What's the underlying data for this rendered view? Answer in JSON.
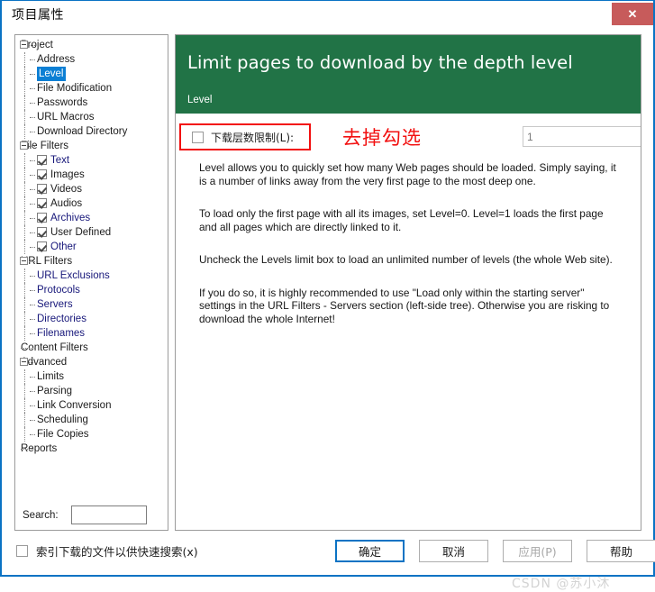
{
  "window": {
    "title": "项目属性",
    "close_label": "✕"
  },
  "tree": {
    "nodes": [
      {
        "label": "Project",
        "level": 0,
        "expander": "minus",
        "color": "black",
        "checkbox": false,
        "selected": false
      },
      {
        "label": "Address",
        "level": 1,
        "expander": "none",
        "color": "black",
        "checkbox": false,
        "selected": false
      },
      {
        "label": "Level",
        "level": 1,
        "expander": "none",
        "color": "black",
        "checkbox": false,
        "selected": true
      },
      {
        "label": "File Modification",
        "level": 1,
        "expander": "none",
        "color": "black",
        "checkbox": false,
        "selected": false
      },
      {
        "label": "Passwords",
        "level": 1,
        "expander": "none",
        "color": "black",
        "checkbox": false,
        "selected": false
      },
      {
        "label": "URL Macros",
        "level": 1,
        "expander": "none",
        "color": "black",
        "checkbox": false,
        "selected": false
      },
      {
        "label": "Download Directory",
        "level": 1,
        "expander": "none",
        "color": "black",
        "checkbox": false,
        "selected": false
      },
      {
        "label": "File Filters",
        "level": 0,
        "expander": "minus",
        "color": "black",
        "checkbox": false,
        "selected": false
      },
      {
        "label": "Text",
        "level": 1,
        "expander": "none",
        "color": "blue",
        "checkbox": true,
        "checked": true,
        "selected": false
      },
      {
        "label": "Images",
        "level": 1,
        "expander": "none",
        "color": "black",
        "checkbox": true,
        "checked": true,
        "selected": false
      },
      {
        "label": "Videos",
        "level": 1,
        "expander": "none",
        "color": "black",
        "checkbox": true,
        "checked": true,
        "selected": false
      },
      {
        "label": "Audios",
        "level": 1,
        "expander": "none",
        "color": "black",
        "checkbox": true,
        "checked": true,
        "selected": false
      },
      {
        "label": "Archives",
        "level": 1,
        "expander": "none",
        "color": "blue",
        "checkbox": true,
        "checked": true,
        "selected": false
      },
      {
        "label": "User Defined",
        "level": 1,
        "expander": "none",
        "color": "black",
        "checkbox": true,
        "checked": true,
        "selected": false
      },
      {
        "label": "Other",
        "level": 1,
        "expander": "none",
        "color": "blue",
        "checkbox": true,
        "checked": true,
        "selected": false
      },
      {
        "label": "URL Filters",
        "level": 0,
        "expander": "minus",
        "color": "black",
        "checkbox": false,
        "selected": false
      },
      {
        "label": "URL Exclusions",
        "level": 1,
        "expander": "none",
        "color": "blue",
        "checkbox": false,
        "selected": false
      },
      {
        "label": "Protocols",
        "level": 1,
        "expander": "none",
        "color": "blue",
        "checkbox": false,
        "selected": false
      },
      {
        "label": "Servers",
        "level": 1,
        "expander": "none",
        "color": "blue",
        "checkbox": false,
        "selected": false
      },
      {
        "label": "Directories",
        "level": 1,
        "expander": "none",
        "color": "blue",
        "checkbox": false,
        "selected": false
      },
      {
        "label": "Filenames",
        "level": 1,
        "expander": "none",
        "color": "blue",
        "checkbox": false,
        "selected": false
      },
      {
        "label": "Content Filters",
        "level": 0,
        "expander": "none",
        "color": "black",
        "checkbox": false,
        "selected": false
      },
      {
        "label": "Advanced",
        "level": 0,
        "expander": "minus",
        "color": "black",
        "checkbox": false,
        "selected": false
      },
      {
        "label": "Limits",
        "level": 1,
        "expander": "none",
        "color": "black",
        "checkbox": false,
        "selected": false
      },
      {
        "label": "Parsing",
        "level": 1,
        "expander": "none",
        "color": "black",
        "checkbox": false,
        "selected": false
      },
      {
        "label": "Link Conversion",
        "level": 1,
        "expander": "none",
        "color": "black",
        "checkbox": false,
        "selected": false
      },
      {
        "label": "Scheduling",
        "level": 1,
        "expander": "none",
        "color": "black",
        "checkbox": false,
        "selected": false
      },
      {
        "label": "File Copies",
        "level": 1,
        "expander": "none",
        "color": "black",
        "checkbox": false,
        "selected": false
      },
      {
        "label": "Reports",
        "level": 0,
        "expander": "none",
        "color": "black",
        "checkbox": false,
        "selected": false
      }
    ],
    "search_label": "Search:",
    "search_value": "",
    "search_placeholder": ""
  },
  "content": {
    "header_title": "Limit pages to download by the depth level",
    "header_subtitle": "Level",
    "limit_checkbox_label": "下载层数限制(L):",
    "limit_checked": false,
    "annotation": "去掉勾选",
    "spinner_value": "1",
    "spinner_up": "▲",
    "spinner_down": "▼",
    "paragraphs": [
      "Level allows you to quickly set how many Web pages should be loaded. Simply saying, it is a number of links away from the very first page to the most deep one.",
      "To load only the first page with all its images, set Level=0. Level=1 loads the first page and all pages which are directly linked to it.",
      "Uncheck the Levels limit box to load an unlimited number of levels (the whole Web site).",
      "If you do so, it is highly recommended to use \"Load only within the starting server\" settings in the URL Filters - Servers section (left-side tree). Otherwise you are risking to download the whole Internet!"
    ]
  },
  "footer": {
    "index_checkbox_label": "索引下载的文件以供快速搜索(x)",
    "index_checked": false,
    "buttons": [
      {
        "label": "确定",
        "state": "default"
      },
      {
        "label": "取消",
        "state": "normal"
      },
      {
        "label": "应用(P)",
        "state": "disabled"
      },
      {
        "label": "帮助",
        "state": "normal"
      }
    ]
  },
  "watermark": "CSDN @苏小沐",
  "colors": {
    "header_green": "#217346",
    "annotation_red": "#f20f0f",
    "selection_blue": "#0c7fd4",
    "window_border": "#0a73c4",
    "close_red": "#c75b5b",
    "tree_blue_text": "#17177a"
  }
}
